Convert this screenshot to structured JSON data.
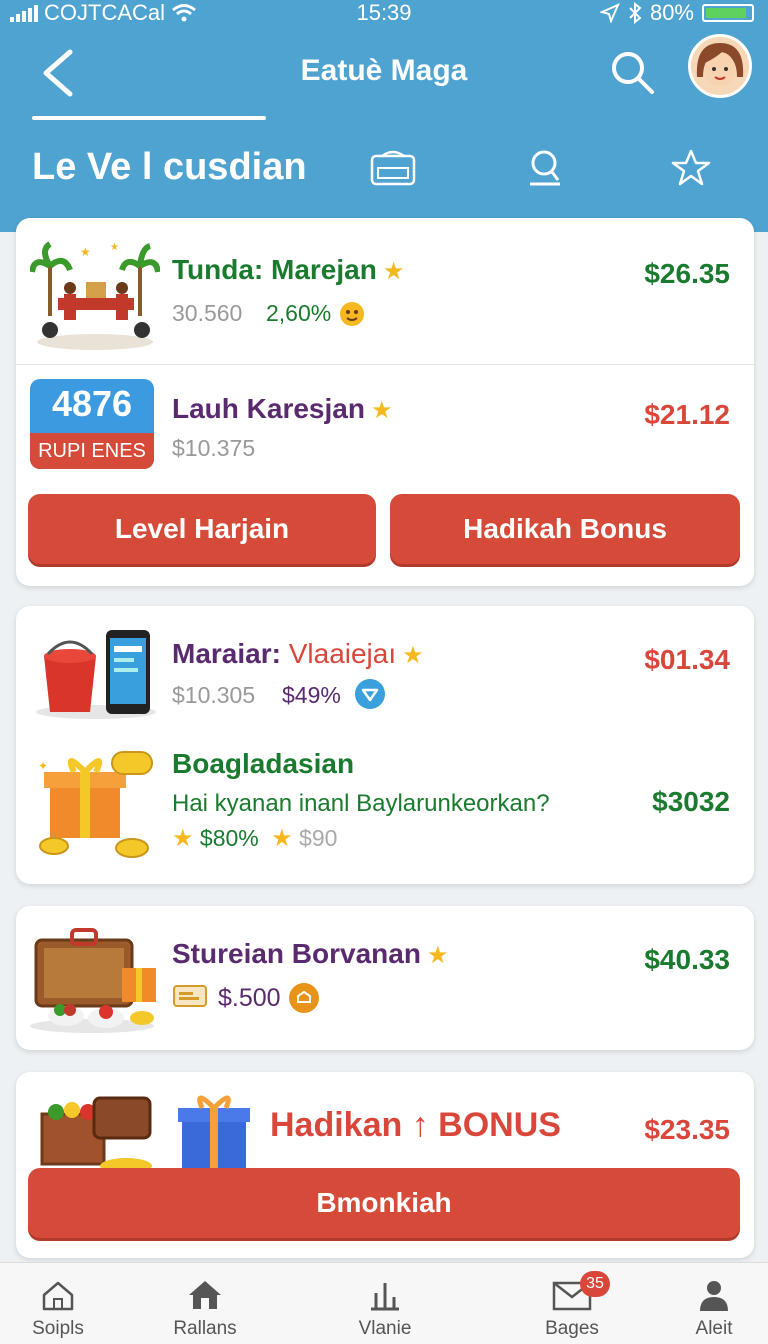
{
  "status": {
    "carrier": "COJTCACal",
    "time": "15:39",
    "battery": "80%"
  },
  "nav": {
    "title": "Eatuè Maga"
  },
  "subheader": {
    "title": "Le Ve l cusdian"
  },
  "card1": {
    "item1": {
      "title": "Tunda: Marejan",
      "sub": "30.560",
      "percent": "2,60%",
      "price": "$26.35"
    },
    "item2": {
      "thumb_number": "4876",
      "thumb_label": "RUPI ENES",
      "title": "Lauh Karesjan",
      "sub": "$10.375",
      "price": "$21.12"
    },
    "button_left": "Level Harjain",
    "button_right": "Hadikah Bonus"
  },
  "card2": {
    "item1": {
      "title_prefix": "Maraiar:",
      "title_suffix": "Vlaaiejaı",
      "sub": "$10.305",
      "percent": "$49%",
      "price": "$01.34"
    },
    "item2": {
      "title": "Boagladasian",
      "desc": "Hai kyanan inanl Baylarunkeorkan?",
      "rating": "$80%",
      "old": "$90",
      "price": "$3032"
    }
  },
  "card3": {
    "title": "Stureian Borvanan",
    "sub": "$.500",
    "price": "$40.33"
  },
  "card4": {
    "title_left": "Hadikan",
    "title_right": "BONUS",
    "price": "$23.35",
    "button": "Bmonkiah"
  },
  "tabs": [
    {
      "label": "Soipls",
      "icon": "home-icon"
    },
    {
      "label": "Rallans",
      "icon": "house-icon"
    },
    {
      "label": "Vlanie",
      "icon": "chart-icon"
    },
    {
      "label": "Bages",
      "icon": "mail-icon",
      "badge": "35"
    },
    {
      "label": "Aleit",
      "icon": "person-icon"
    }
  ],
  "colors": {
    "header": "#4fa3d1",
    "accent_red": "#d54a38",
    "green": "#1a7a2e",
    "purple": "#5a2a6e"
  }
}
